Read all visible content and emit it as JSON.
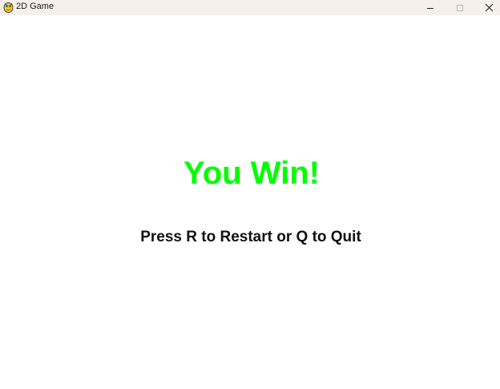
{
  "window": {
    "title": "2D Game",
    "controls": {
      "minimize": "minimize-icon",
      "maximize": "maximize-icon",
      "close": "close-icon"
    },
    "app_icon": "pygame-snake-icon"
  },
  "game": {
    "result_text": "You Win!",
    "result_color": "#00ff00",
    "instruction_text": "Press R to Restart or Q to Quit",
    "background_color": "#ffffff"
  }
}
